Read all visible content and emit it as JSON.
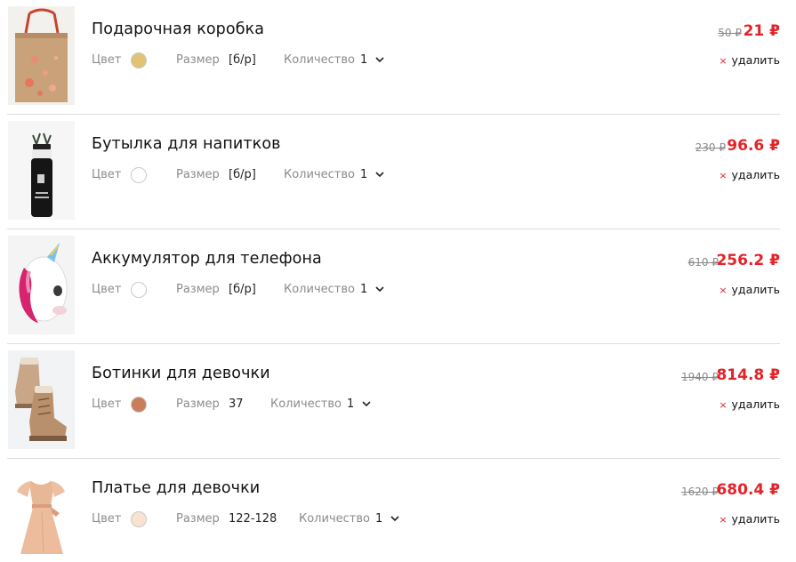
{
  "labels": {
    "color": "Цвет",
    "size": "Размер",
    "quantity": "Количество",
    "remove": "удалить",
    "remove_icon": "×"
  },
  "items": [
    {
      "name": "Подарочная коробка",
      "size": "[б/р]",
      "qty": "1",
      "old_price": "50 ₽",
      "price": "21 ₽",
      "color_hex": "#e2c275",
      "image": "gift-bag-image"
    },
    {
      "name": "Бутылка для напитков",
      "size": "[б/р]",
      "qty": "1",
      "old_price": "230 ₽",
      "price": "96.6 ₽",
      "color_hex": "#ffffff",
      "image": "bottle-image"
    },
    {
      "name": "Аккумулятор для телефона",
      "size": "[б/р]",
      "qty": "1",
      "old_price": "610 ₽",
      "price": "256.2 ₽",
      "color_hex": "#ffffff",
      "image": "unicorn-power-bank-image"
    },
    {
      "name": "Ботинки для девочки",
      "size": "37",
      "qty": "1",
      "old_price": "1940 ₽",
      "price": "814.8 ₽",
      "color_hex": "#c97d58",
      "image": "boots-image"
    },
    {
      "name": "Платье для девочки",
      "size": "122-128",
      "qty": "1",
      "old_price": "1620 ₽",
      "price": "680.4 ₽",
      "color_hex": "#f7e3cf",
      "image": "dress-image"
    }
  ]
}
